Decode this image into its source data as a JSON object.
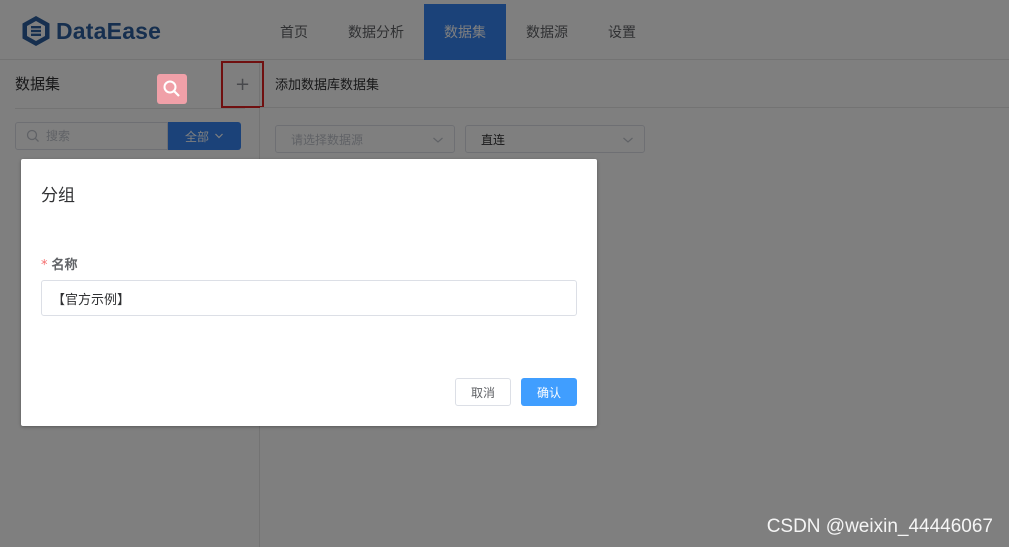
{
  "app": {
    "logo_text": "DataEase"
  },
  "nav": {
    "items": [
      {
        "label": "首页",
        "active": false
      },
      {
        "label": "数据分析",
        "active": false
      },
      {
        "label": "数据集",
        "active": true
      },
      {
        "label": "数据源",
        "active": false
      },
      {
        "label": "设置",
        "active": false
      }
    ]
  },
  "sidebar": {
    "title": "数据集",
    "add_label": "+",
    "search_placeholder": "搜索",
    "filter_label": "全部"
  },
  "main": {
    "title": "添加数据库数据集",
    "datasource_placeholder": "请选择数据源",
    "mode_value": "直连"
  },
  "dialog": {
    "title": "分组",
    "field_label": "名称",
    "required_mark": "*",
    "field_value": "【官方示例】",
    "cancel_label": "取消",
    "confirm_label": "确认"
  },
  "watermark": "CSDN @weixin_44446067",
  "colors": {
    "accent": "#3685f2",
    "primary_button": "#409eff",
    "highlight_border": "#e02020",
    "brand_text": "#2c5f9e"
  },
  "icons": {
    "logo": "dataease-logo-icon",
    "search": "search-icon",
    "dropdown": "chevron-down-icon",
    "cursor": "magnifier-cursor-icon"
  }
}
